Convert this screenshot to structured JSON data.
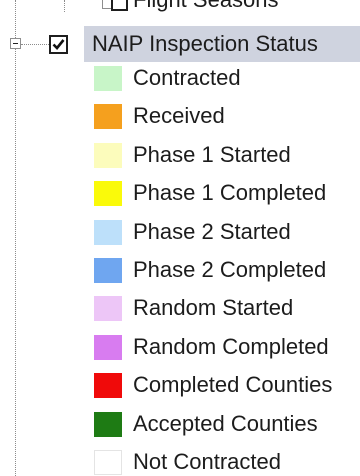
{
  "tree": {
    "previous_layer": {
      "label": "Flight Seasons",
      "checked": false
    },
    "layer": {
      "label": "NAIP Inspection Status",
      "checked": true,
      "expanded": true
    },
    "legend": [
      {
        "label": "Contracted",
        "color": "#c8f5c8"
      },
      {
        "label": "Received",
        "color": "#f5a01e"
      },
      {
        "label": "Phase 1 Started",
        "color": "#fcfcbc"
      },
      {
        "label": "Phase 1 Completed",
        "color": "#fafa0a"
      },
      {
        "label": "Phase 2 Started",
        "color": "#bde0fa"
      },
      {
        "label": "Phase 2 Completed",
        "color": "#6fa6f0"
      },
      {
        "label": "Random Started",
        "color": "#edc6f7"
      },
      {
        "label": "Random Completed",
        "color": "#d87cf0"
      },
      {
        "label": "Completed Counties",
        "color": "#f00a0a"
      },
      {
        "label": "Accepted Counties",
        "color": "#1e7b14"
      },
      {
        "label": "Not Contracted",
        "color": "#ffffff"
      }
    ]
  }
}
